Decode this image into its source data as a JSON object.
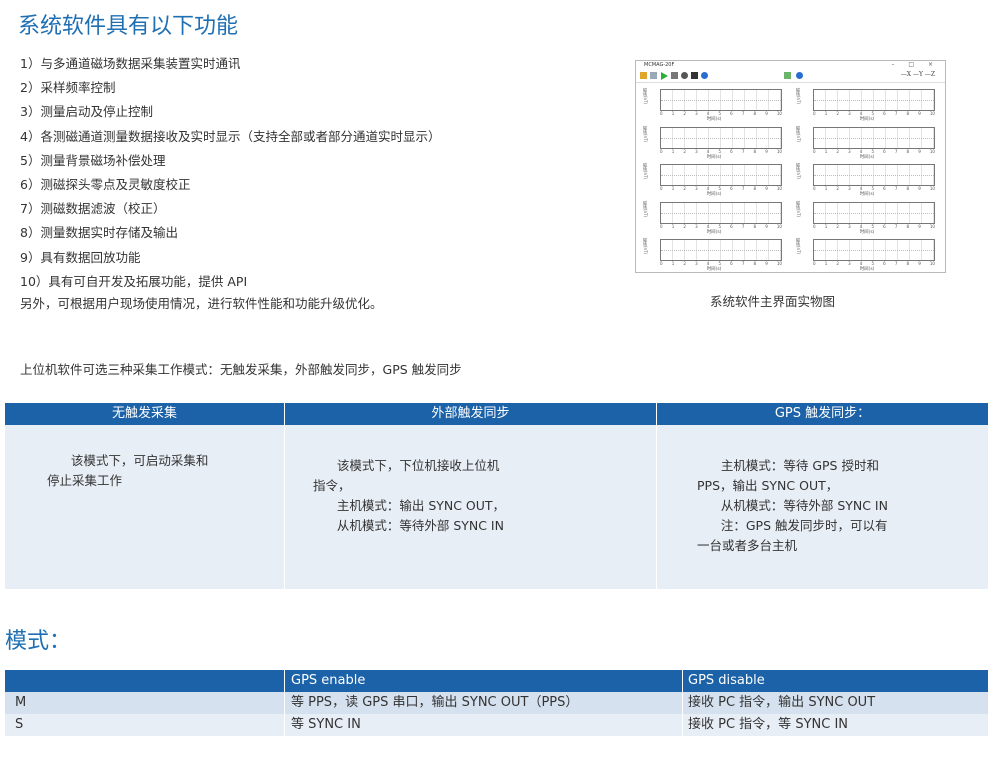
{
  "section1": {
    "title": "系统软件具有以下功能",
    "features": [
      "1）与多通道磁场数据采集装置实时通讯",
      "2）采样频率控制",
      "3）测量启动及停止控制",
      "4）各测磁通道测量数据接收及实时显示（支持全部或者部分通道实时显示）",
      "5）测量背景磁场补偿处理",
      "6）测磁探头零点及灵敏度校正",
      "7）测磁数据滤波（校正）",
      "8）测量数据实时存储及输出",
      "9）具有数据回放功能",
      "10）具有可自开发及拓展功能，提供 API"
    ],
    "extra": "另外，可根据用户现场使用情况，进行软件性能和功能升级优化。",
    "screenshot": {
      "window_title": "MCMAG-20F",
      "window_controls": "– □ ×",
      "axes_label": "—X —Y —Z",
      "x_label": "时间(s)",
      "y_label": "磁场(nT)",
      "x_ticks": [
        "0",
        "1",
        "2",
        "3",
        "4",
        "5",
        "6",
        "7",
        "8",
        "9",
        "10"
      ],
      "panel_count": 10
    },
    "caption": "系统软件主界面实物图"
  },
  "intro": "上位机软件可选三种采集工作模式：无触发采集，外部触发同步，GPS 触发同步",
  "modes_table": {
    "headers": [
      "无触发采集",
      "外部触发同步",
      "GPS 触发同步："
    ],
    "col1": [
      "      该模式下，可启动采集和",
      "停止采集工作"
    ],
    "col2": [
      "      该模式下，下位机接收上位机",
      "指令，",
      "      主机模式：输出 SYNC OUT，",
      "      从机模式：等待外部 SYNC IN"
    ],
    "col3": [
      "      主机模式：等待 GPS 授时和",
      "PPS，输出 SYNC OUT，",
      "      从机模式：等待外部 SYNC IN",
      "      注：GPS 触发同步时，可以有",
      "一台或者多台主机"
    ]
  },
  "mode_section": {
    "title": "模式："
  },
  "gps_table": {
    "headers": [
      "",
      "GPS enable",
      "GPS disable"
    ],
    "rows": [
      [
        "M",
        "等 PPS，读 GPS 串口，输出 SYNC OUT（PPS）",
        "接收 PC 指令，输出 SYNC OUT"
      ],
      [
        "S",
        "等 SYNC IN",
        "接收 PC 指令，等 SYNC IN"
      ]
    ]
  },
  "colors": {
    "heading": "#1f6fb3",
    "table_header": "#1b62a8",
    "table_body": "#e8eef6",
    "table_row_alt": "#d5e1ef"
  }
}
